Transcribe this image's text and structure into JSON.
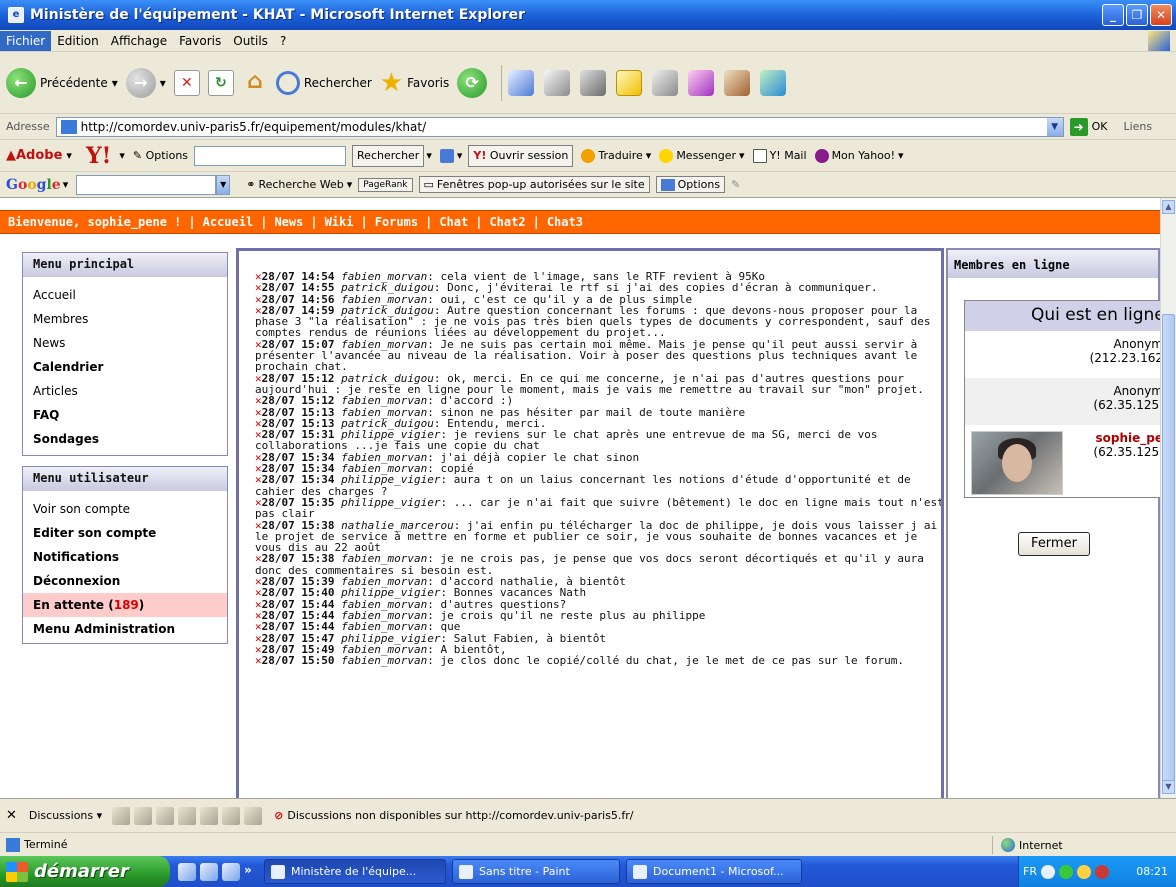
{
  "window": {
    "title": "Ministère de l'équipement - KHAT - Microsoft Internet Explorer"
  },
  "menubar": [
    "Fichier",
    "Edition",
    "Affichage",
    "Favoris",
    "Outils",
    "?"
  ],
  "toolbar": {
    "back_label": "Précédente",
    "search_label": "Rechercher",
    "favorites_label": "Favoris"
  },
  "address": {
    "label": "Adresse",
    "url": "http://comordev.univ-paris5.fr/equipement/modules/khat/",
    "go_label": "OK",
    "links_label": "Liens"
  },
  "yahoo": {
    "adobe_label": "Adobe",
    "options_label": "Options",
    "search_button": "Rechercher",
    "session_label": "Ouvrir session",
    "translate_label": "Traduire",
    "messenger_label": "Messenger",
    "mail_label": "Y! Mail",
    "myyahoo_label": "Mon Yahoo!"
  },
  "google": {
    "web_search_label": "Recherche Web",
    "pagerank_label": "PageRank",
    "popup_label": "Fenêtres pop-up autorisées sur le site",
    "options_label": "Options"
  },
  "page": {
    "nav": {
      "welcome": "Bienvenue, sophie_pene !",
      "items": [
        "Accueil",
        "News",
        "Wiki",
        "Forums",
        "Chat",
        "Chat2",
        "Chat3"
      ]
    },
    "main_menu": {
      "title": "Menu principal",
      "items": [
        {
          "label": "Accueil"
        },
        {
          "label": "Membres"
        },
        {
          "label": "News"
        },
        {
          "label": "Calendrier"
        },
        {
          "label": "Articles"
        },
        {
          "label": "FAQ"
        },
        {
          "label": "Sondages"
        }
      ]
    },
    "user_menu": {
      "title": "Menu utilisateur",
      "items": [
        {
          "label": "Voir son compte"
        },
        {
          "label": "Editer son compte"
        },
        {
          "label": "Notifications"
        },
        {
          "label": "Déconnexion"
        },
        {
          "label": "En attente (",
          "count": "189",
          "suffix": ")"
        },
        {
          "label": "Menu Administration"
        }
      ]
    },
    "chat": [
      {
        "time": "28/07 14:54",
        "user": "fabien_morvan",
        "msg": ": cela vient de l'image, sans le RTF revient à 95Ko"
      },
      {
        "time": "28/07 14:55",
        "user": "patrick_duigou",
        "msg": ": Donc, j'éviterai le rtf si j'ai des copies d'écran à communiquer."
      },
      {
        "time": "28/07 14:56",
        "user": "fabien_morvan",
        "msg": ": oui, c'est ce qu'il y a de plus simple"
      },
      {
        "time": "28/07 14:59",
        "user": "patrick_duigou",
        "msg": ": Autre question concernant les forums : que devons-nous proposer pour la phase 3 \"la réalisation\" : je ne vois pas très bien quels types de documents y correspondent, sauf des comptes rendus de réunions liées au développement du projet..."
      },
      {
        "time": "28/07 15:07",
        "user": "fabien_morvan",
        "msg": ": Je ne suis pas certain moi même. Mais je pense qu'il peut aussi servir à présenter l'avancée au niveau de la réalisation. Voir à poser des questions plus techniques avant le prochain chat."
      },
      {
        "time": "28/07 15:12",
        "user": "patrick_duigou",
        "msg": ": ok, merci. En ce qui me concerne, je n'ai pas d'autres questions pour aujourd'hui : je reste en ligne pour le moment, mais je vais me remettre au travail sur \"mon\" projet."
      },
      {
        "time": "28/07 15:12",
        "user": "fabien_morvan",
        "msg": ": d'accord :)"
      },
      {
        "time": "28/07 15:13",
        "user": "fabien_morvan",
        "msg": ": sinon ne pas hésiter par mail de toute manière"
      },
      {
        "time": "28/07 15:13",
        "user": "patrick_duigou",
        "msg": ": Entendu, merci."
      },
      {
        "time": "28/07 15:31",
        "user": "philippe_vigier",
        "msg": ": je reviens sur le chat après une entrevue de ma SG, merci de vos collaborations ...je fais une copie du chat"
      },
      {
        "time": "28/07 15:34",
        "user": "fabien_morvan",
        "msg": ": j'ai déjà copier le chat sinon"
      },
      {
        "time": "28/07 15:34",
        "user": "fabien_morvan",
        "msg": ": copié"
      },
      {
        "time": "28/07 15:34",
        "user": "philippe_vigier",
        "msg": ": aura t on un laius concernant les notions d'étude d'opportunité et de cahier des charges ?"
      },
      {
        "time": "28/07 15:35",
        "user": "philippe_vigier",
        "msg": ": ... car je n'ai fait que suivre (bêtement) le doc en ligne mais tout n'est pas clair"
      },
      {
        "time": "28/07 15:38",
        "user": "nathalie_marcerou",
        "msg": ": j'ai enfin pu télécharger la doc de philippe, je dois vous laisser j ai le projet de service à mettre en forme et publier ce soir, je vous souhaite de bonnes vacances et je vous dis au 22 août"
      },
      {
        "time": "28/07 15:38",
        "user": "fabien_morvan",
        "msg": ": je ne crois pas, je pense que vos docs seront décortiqués et qu'il y aura donc des commentaires si besoin est."
      },
      {
        "time": "28/07 15:39",
        "user": "fabien_morvan",
        "msg": ": d'accord nathalie, à bientôt"
      },
      {
        "time": "28/07 15:40",
        "user": "philippe_vigier",
        "msg": ": Bonnes vacances Nath"
      },
      {
        "time": "28/07 15:44",
        "user": "fabien_morvan",
        "msg": ": d'autres questions?"
      },
      {
        "time": "28/07 15:44",
        "user": "fabien_morvan",
        "msg": ": je crois qu'il ne reste plus au philippe"
      },
      {
        "time": "28/07 15:44",
        "user": "fabien_morvan",
        "msg": ": que"
      },
      {
        "time": "28/07 15:47",
        "user": "philippe_vigier",
        "msg": ": Salut Fabien, à bientôt"
      },
      {
        "time": "28/07 15:49",
        "user": "fabien_morvan",
        "msg": ": A bientôt,"
      },
      {
        "time": "28/07 15:50",
        "user": "fabien_morvan",
        "msg": ": je clos donc le copié/collé du chat, je le met de ce pas sur le forum."
      }
    ],
    "members_panel": {
      "title": "Membres en ligne",
      "popup_title": "Qui est en ligne",
      "entries": [
        {
          "name": "Anonym",
          "ip": "(212.23.162"
        },
        {
          "name": "Anonym",
          "ip": "(62.35.125."
        },
        {
          "name": "sophie_pe",
          "ip": "(62.35.125."
        }
      ],
      "close_button": "Fermer"
    }
  },
  "discussions": {
    "label": "Discussions",
    "message": "Discussions non disponibles sur http://comordev.univ-paris5.fr/"
  },
  "status": {
    "text": "Terminé",
    "zone": "Internet"
  },
  "taskbar": {
    "start_label": "démarrer",
    "tasks": [
      "Ministère de l'équipe...",
      "Sans titre - Paint",
      "Document1 - Microsof..."
    ],
    "lang": "FR",
    "clock": "08:21"
  }
}
